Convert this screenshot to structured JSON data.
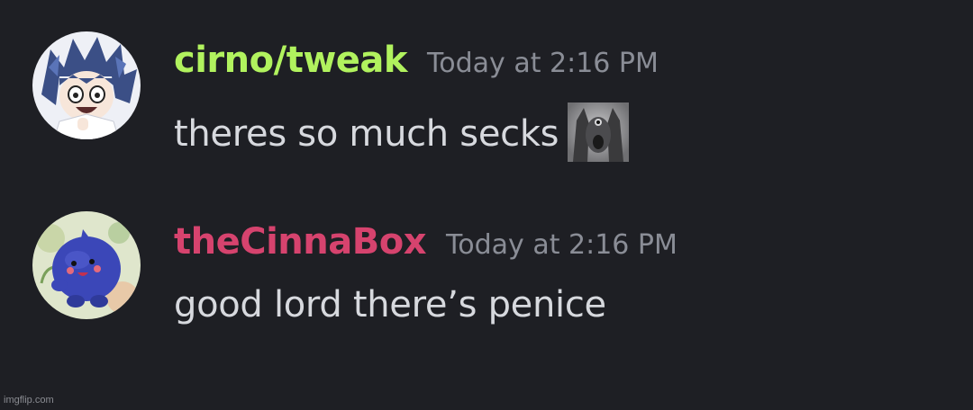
{
  "messages": [
    {
      "username": "cirno/tweak",
      "username_color": "#b1f25e",
      "timestamp": "Today at 2:16 PM",
      "text": "theres so much secks",
      "emoji": "screaming-face-emoji",
      "avatar": "anime-character-avatar"
    },
    {
      "username": "theCinnaBox",
      "username_color": "#d6436e",
      "timestamp": "Today at 2:16 PM",
      "text": "good lord there’s penice",
      "avatar": "blue-creature-avatar"
    }
  ],
  "watermark": "imgflip.com",
  "colors": {
    "background": "#1e1f24",
    "message_text": "#d7d9de",
    "timestamp": "#8a8d96"
  }
}
